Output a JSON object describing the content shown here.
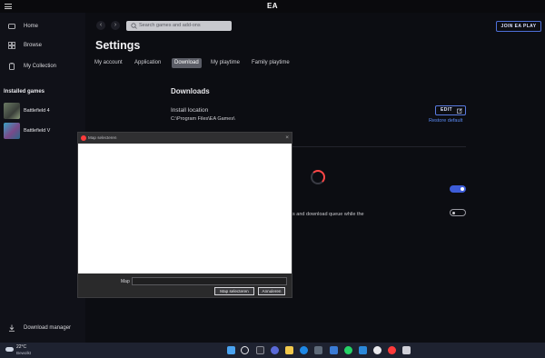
{
  "app": {
    "logo": "EA"
  },
  "sidebar": {
    "items": [
      {
        "label": "Home",
        "icon": "home-icon"
      },
      {
        "label": "Browse",
        "icon": "browse-icon"
      },
      {
        "label": "My Collection",
        "icon": "collection-icon"
      }
    ],
    "installed_title": "Installed games",
    "games": [
      {
        "label": "Battlefield 4"
      },
      {
        "label": "Battlefield V"
      }
    ],
    "download_manager": "Download manager"
  },
  "header": {
    "search_placeholder": "Search games and add-ons",
    "join_label": "JOIN EA PLAY"
  },
  "settings": {
    "title": "Settings",
    "tabs": [
      "My account",
      "Application",
      "Download",
      "My playtime",
      "Family playtime"
    ],
    "active_tab": "Download",
    "downloads": {
      "heading": "Downloads",
      "install_location_label": "Install location",
      "install_path": "C:\\Program Files\\EA Games\\",
      "edit_label": "EDIT",
      "restore_label": "Restore default",
      "partial_text": "s and download queue while the"
    }
  },
  "dialog": {
    "title": "Map selecteren",
    "field_label": "Map",
    "field_value": "",
    "ok_label": "Map selecteren",
    "cancel_label": "Annuleren"
  },
  "taskbar": {
    "temperature": "22°C",
    "condition": "Bewolkt"
  },
  "colors": {
    "accent": "#4e6fd8",
    "spinner": "#ff4747",
    "link": "#5b8bf5"
  }
}
